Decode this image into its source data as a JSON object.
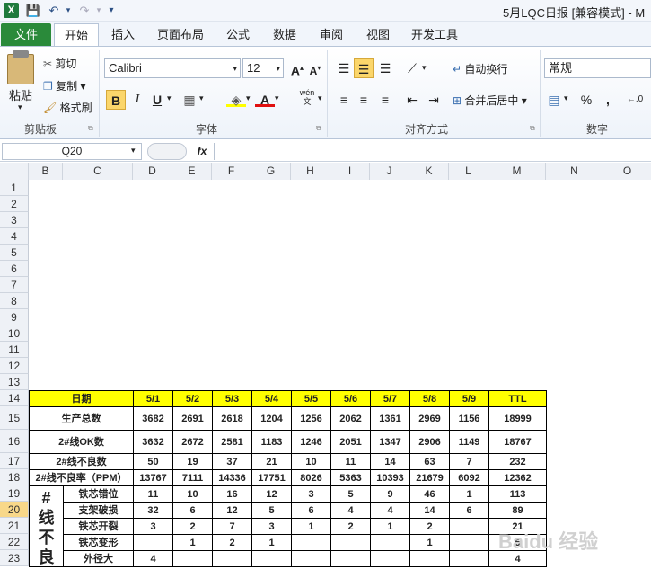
{
  "titlebar": {
    "app_icon": "X",
    "save_icon": "save-icon",
    "undo_icon": "undo-icon",
    "redo_icon": "redo-icon",
    "doc_title": "5月LQC日报  [兼容模式] - M"
  },
  "tabs": [
    "文件",
    "开始",
    "插入",
    "页面布局",
    "公式",
    "数据",
    "审阅",
    "视图",
    "开发工具"
  ],
  "ribbon": {
    "clipboard": {
      "paste": "粘贴",
      "cut": "剪切",
      "copy": "复制 ▾",
      "format_painter": "格式刷",
      "label": "剪贴板"
    },
    "font": {
      "name": "Calibri",
      "size": "12",
      "bold": "B",
      "italic": "I",
      "underline": "U",
      "label": "字体",
      "wen": "wén\n文"
    },
    "alignment": {
      "wrap": "自动换行",
      "merge": "合并后居中 ▾",
      "label": "对齐方式"
    },
    "number": {
      "format": "常规",
      "percent": "%",
      "comma": ",",
      "label": "数字"
    }
  },
  "formula_bar": {
    "cell_ref": "Q20",
    "fx": "fx",
    "formula": ""
  },
  "columns": [
    "B",
    "C",
    "D",
    "E",
    "F",
    "G",
    "H",
    "I",
    "J",
    "K",
    "L",
    "M",
    "N",
    "O"
  ],
  "rows": [
    "1",
    "2",
    "3",
    "4",
    "5",
    "6",
    "7",
    "8",
    "9",
    "10",
    "11",
    "12",
    "13",
    "14",
    "15",
    "16",
    "17",
    "18",
    "19",
    "20",
    "21",
    "22",
    "23"
  ],
  "table": {
    "header": [
      "日期",
      "5/1",
      "5/2",
      "5/3",
      "5/4",
      "5/5",
      "5/6",
      "5/7",
      "5/8",
      "5/9",
      "TTL"
    ],
    "rows": [
      [
        "生产总数",
        "3682",
        "2691",
        "2618",
        "1204",
        "1256",
        "2062",
        "1361",
        "2969",
        "1156",
        "18999"
      ],
      [
        "2#线OK数",
        "3632",
        "2672",
        "2581",
        "1183",
        "1246",
        "2051",
        "1347",
        "2906",
        "1149",
        "18767"
      ],
      [
        "2#线不良数",
        "50",
        "19",
        "37",
        "21",
        "10",
        "11",
        "14",
        "63",
        "7",
        "232"
      ],
      [
        "2#线不良率（PPM）",
        "13767",
        "7111",
        "14336",
        "17751",
        "8026",
        "5363",
        "10393",
        "21679",
        "6092",
        "12362"
      ]
    ],
    "defect_group_label": "#\n线\n不\n良",
    "defects": [
      [
        "铁芯错位",
        "11",
        "10",
        "16",
        "12",
        "3",
        "5",
        "9",
        "46",
        "1",
        "113"
      ],
      [
        "支架破损",
        "32",
        "6",
        "12",
        "5",
        "6",
        "4",
        "4",
        "14",
        "6",
        "89"
      ],
      [
        "铁芯开裂",
        "3",
        "2",
        "7",
        "3",
        "1",
        "2",
        "1",
        "2",
        "",
        "21"
      ],
      [
        "铁芯变形",
        "",
        "1",
        "2",
        "1",
        "",
        "",
        "",
        "1",
        "",
        "5"
      ],
      [
        "外径大",
        "4",
        "",
        "",
        "",
        "",
        "",
        "",
        "",
        "",
        "4"
      ]
    ]
  },
  "watermark": "Baidu 经验"
}
